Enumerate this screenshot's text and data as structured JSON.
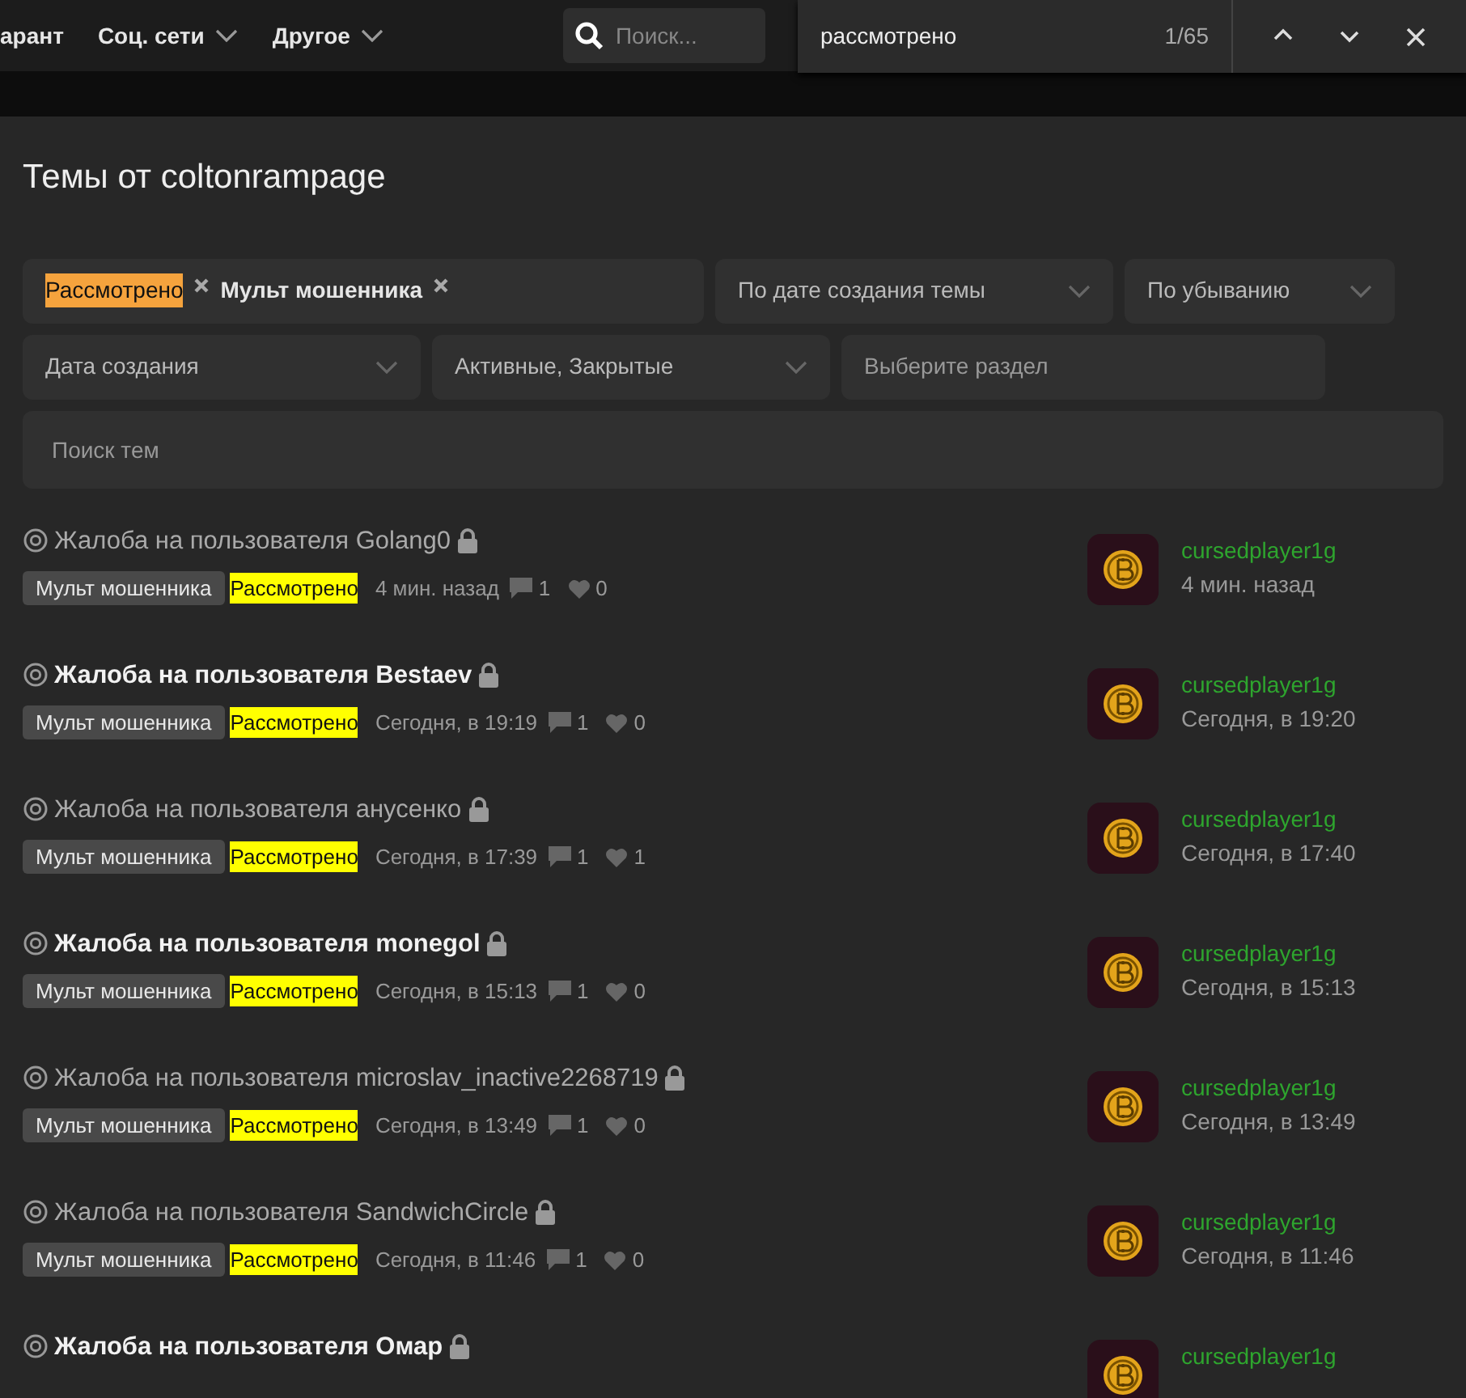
{
  "nav": {
    "items": [
      {
        "label": "арант",
        "caret": false
      },
      {
        "label": "Соц. сети",
        "caret": true
      },
      {
        "label": "Другое",
        "caret": true
      }
    ],
    "search": {
      "placeholder": "Поиск..."
    }
  },
  "find_bar": {
    "query": "рассмотрено",
    "count": "1/65"
  },
  "page_title": "Темы от coltonrampage",
  "filters": {
    "tags": [
      {
        "label": "Рассмотрено",
        "current_match": true
      },
      {
        "label": "Мульт мошенника",
        "current_match": false
      }
    ],
    "sort": "По дате создания темы",
    "order": "По убыванию",
    "date": "Дата создания",
    "state": "Активные, Закрытые",
    "section_placeholder": "Выберите раздел",
    "search_placeholder": "Поиск тем"
  },
  "threads": [
    {
      "title": "Жалоба на пользователя Golang0",
      "unread": false,
      "prefix": "Мульт мошенника",
      "status": "Рассмотрено",
      "date": "4 мин. назад",
      "replies": "1",
      "likes": "0",
      "last_user": "cursedplayer1g",
      "last_time": "4 мин. назад"
    },
    {
      "title": "Жалоба на пользователя Bestaev",
      "unread": true,
      "prefix": "Мульт мошенника",
      "status": "Рассмотрено",
      "date": "Сегодня, в 19:19",
      "replies": "1",
      "likes": "0",
      "last_user": "cursedplayer1g",
      "last_time": "Сегодня, в 19:20"
    },
    {
      "title": "Жалоба на пользователя анусенко",
      "unread": false,
      "prefix": "Мульт мошенника",
      "status": "Рассмотрено",
      "date": "Сегодня, в 17:39",
      "replies": "1",
      "likes": "1",
      "last_user": "cursedplayer1g",
      "last_time": "Сегодня, в 17:40"
    },
    {
      "title": "Жалоба на пользователя monegol",
      "unread": true,
      "prefix": "Мульт мошенника",
      "status": "Рассмотрено",
      "date": "Сегодня, в 15:13",
      "replies": "1",
      "likes": "0",
      "last_user": "cursedplayer1g",
      "last_time": "Сегодня, в 15:13"
    },
    {
      "title": "Жалоба на пользователя microslav_inactive2268719",
      "unread": false,
      "prefix": "Мульт мошенника",
      "status": "Рассмотрено",
      "date": "Сегодня, в 13:49",
      "replies": "1",
      "likes": "0",
      "last_user": "cursedplayer1g",
      "last_time": "Сегодня, в 13:49"
    },
    {
      "title": "Жалоба на пользователя SandwichCircle",
      "unread": false,
      "prefix": "Мульт мошенника",
      "status": "Рассмотрено",
      "date": "Сегодня, в 11:46",
      "replies": "1",
      "likes": "0",
      "last_user": "cursedplayer1g",
      "last_time": "Сегодня, в 11:46"
    },
    {
      "title": "Жалоба на пользователя Омар",
      "unread": true,
      "last_user": "cursedplayer1g"
    }
  ]
}
